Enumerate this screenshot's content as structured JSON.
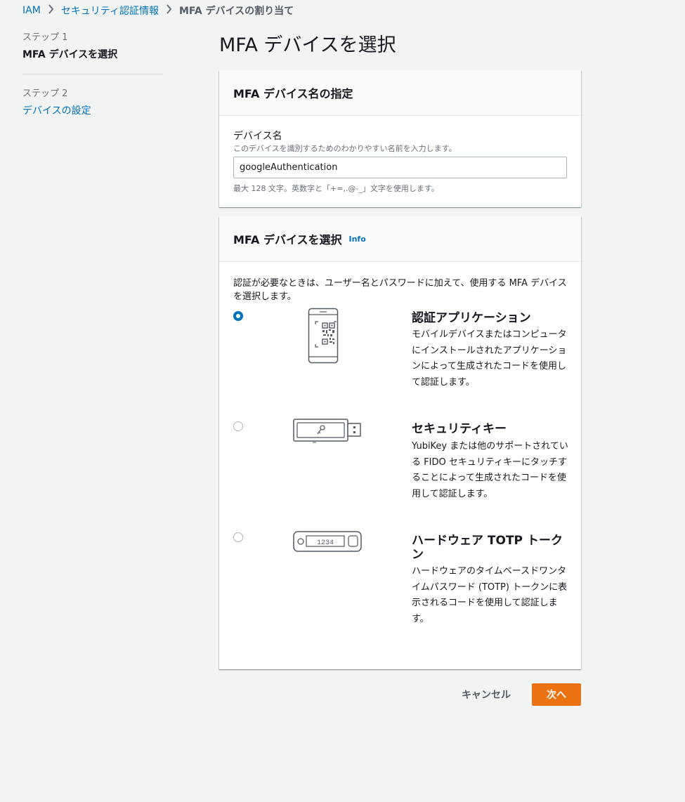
{
  "breadcrumb": {
    "items": [
      "IAM",
      "セキュリティ認証情報"
    ],
    "current": "MFA デバイスの割り当て"
  },
  "steps": [
    {
      "label": "ステップ 1",
      "title": "MFA デバイスを選択"
    },
    {
      "label": "ステップ 2",
      "title": "デバイスの設定"
    }
  ],
  "page_title": "MFA デバイスを選択",
  "device_name_panel": {
    "heading": "MFA デバイス名の指定",
    "field_label": "デバイス名",
    "field_description": "このデバイスを識別するためのわかりやすい名前を入力します。",
    "value": "googleAuthentication",
    "hint": "最大 128 文字。英数字と「+=,.@-_」文字を使用します。"
  },
  "device_type_panel": {
    "heading": "MFA デバイスを選択",
    "info_link": "Info",
    "intro": "認証が必要なときは、ユーザー名とパスワードに加えて、使用する MFA デバイスを選択します。",
    "options": [
      {
        "title": "認証アプリケーション",
        "description": "モバイルデバイスまたはコンピュータにインストールされたアプリケーションによって生成されたコードを使用して認証します。",
        "selected": true,
        "icon": "phone-qr-icon"
      },
      {
        "title": "セキュリティキー",
        "description": "YubiKey または他のサポートされている FIDO セキュリティキーにタッチすることによって生成されたコードを使用して認証します。",
        "selected": false,
        "icon": "usb-key-icon"
      },
      {
        "title": "ハードウェア TOTP トークン",
        "description": "ハードウェアのタイムベースドワンタイムパスワード (TOTP) トークンに表示されるコードを使用して認証します。",
        "selected": false,
        "icon": "totp-token-icon",
        "token_display": "1234"
      }
    ]
  },
  "footer": {
    "cancel_label": "キャンセル",
    "next_label": "次へ"
  },
  "colors": {
    "accent": "#0073bb",
    "primary_button": "#ec7211",
    "background": "#f2f3f3"
  }
}
